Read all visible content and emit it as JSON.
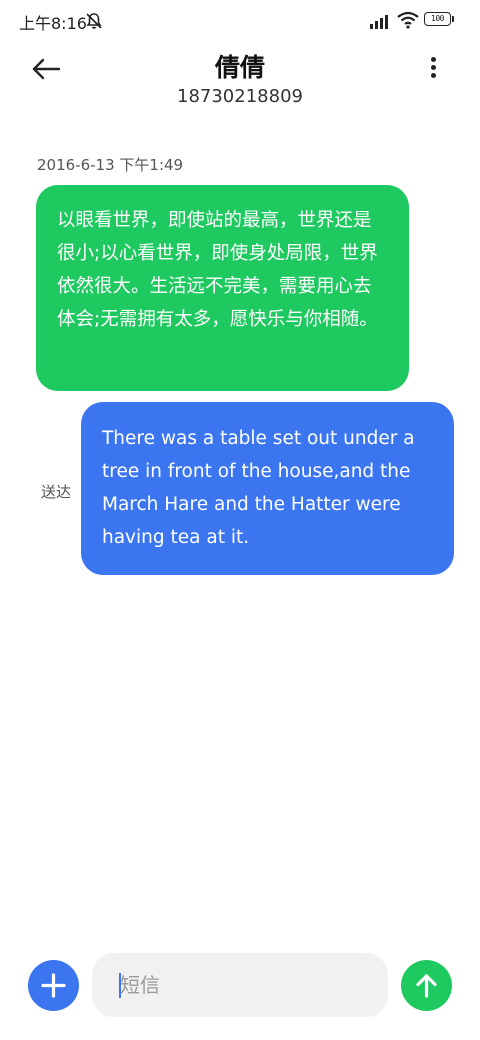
{
  "status_bar": {
    "time": "上午8:16",
    "battery_level": "100",
    "icons": [
      "mute-notifications-icon",
      "cellular-signal-icon",
      "wifi-icon",
      "battery-icon"
    ]
  },
  "header": {
    "back_icon": "arrow-left-icon",
    "contact_name": "倩倩",
    "contact_number": "18730218809",
    "more_icon": "more-vertical-icon"
  },
  "conversation": {
    "timestamp": "2016-6-13 下午1:49",
    "messages": [
      {
        "direction": "received",
        "text": "以眼看世界，即使站的最高，世界还是很小;以心看世界，即使身处局限，世界依然很大。生活远不完美，需要用心去体会;无需拥有太多，愿快乐与你相随。"
      },
      {
        "direction": "sent",
        "text": "There was a table set out under a tree in front of the house,and the March Hare and the Hatter were having tea at it.",
        "status": "送达"
      }
    ]
  },
  "composer": {
    "add_icon": "plus-icon",
    "input_value": "",
    "input_placeholder": "短信",
    "send_icon": "arrow-up-icon"
  },
  "colors": {
    "received_bubble": "#1ec960",
    "sent_bubble": "#3b76f0",
    "send_button": "#1ec960",
    "add_button": "#3b76f0",
    "input_background": "#f1f1f1"
  }
}
